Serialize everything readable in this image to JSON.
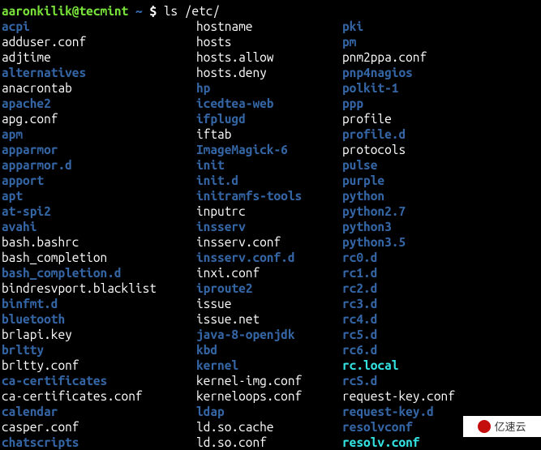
{
  "prompt": {
    "user_host": "aaronkilik@tecmint",
    "tilde": "~",
    "dollar": "$",
    "command": "ls /etc/"
  },
  "columns": [
    [
      {
        "name": "acpi",
        "type": "dir"
      },
      {
        "name": "adduser.conf",
        "type": "file"
      },
      {
        "name": "adjtime",
        "type": "file"
      },
      {
        "name": "alternatives",
        "type": "dir"
      },
      {
        "name": "anacrontab",
        "type": "file"
      },
      {
        "name": "apache2",
        "type": "dir"
      },
      {
        "name": "apg.conf",
        "type": "file"
      },
      {
        "name": "apm",
        "type": "dir"
      },
      {
        "name": "apparmor",
        "type": "dir"
      },
      {
        "name": "apparmor.d",
        "type": "dir"
      },
      {
        "name": "apport",
        "type": "dir"
      },
      {
        "name": "apt",
        "type": "dir"
      },
      {
        "name": "at-spi2",
        "type": "dir"
      },
      {
        "name": "avahi",
        "type": "dir"
      },
      {
        "name": "bash.bashrc",
        "type": "file"
      },
      {
        "name": "bash_completion",
        "type": "file"
      },
      {
        "name": "bash_completion.d",
        "type": "dir"
      },
      {
        "name": "bindresvport.blacklist",
        "type": "file"
      },
      {
        "name": "binfmt.d",
        "type": "dir"
      },
      {
        "name": "bluetooth",
        "type": "dir"
      },
      {
        "name": "brlapi.key",
        "type": "file"
      },
      {
        "name": "brltty",
        "type": "dir"
      },
      {
        "name": "brltty.conf",
        "type": "file"
      },
      {
        "name": "ca-certificates",
        "type": "dir"
      },
      {
        "name": "ca-certificates.conf",
        "type": "file"
      },
      {
        "name": "calendar",
        "type": "dir"
      },
      {
        "name": "casper.conf",
        "type": "file"
      },
      {
        "name": "chatscripts",
        "type": "dir"
      }
    ],
    [
      {
        "name": "hostname",
        "type": "file"
      },
      {
        "name": "hosts",
        "type": "file"
      },
      {
        "name": "hosts.allow",
        "type": "file"
      },
      {
        "name": "hosts.deny",
        "type": "file"
      },
      {
        "name": "hp",
        "type": "dir"
      },
      {
        "name": "icedtea-web",
        "type": "dir"
      },
      {
        "name": "ifplugd",
        "type": "dir"
      },
      {
        "name": "iftab",
        "type": "file"
      },
      {
        "name": "ImageMagick-6",
        "type": "dir"
      },
      {
        "name": "init",
        "type": "dir"
      },
      {
        "name": "init.d",
        "type": "dir"
      },
      {
        "name": "initramfs-tools",
        "type": "dir"
      },
      {
        "name": "inputrc",
        "type": "file"
      },
      {
        "name": "insserv",
        "type": "dir"
      },
      {
        "name": "insserv.conf",
        "type": "file"
      },
      {
        "name": "insserv.conf.d",
        "type": "dir"
      },
      {
        "name": "inxi.conf",
        "type": "file"
      },
      {
        "name": "iproute2",
        "type": "dir"
      },
      {
        "name": "issue",
        "type": "file"
      },
      {
        "name": "issue.net",
        "type": "file"
      },
      {
        "name": "java-8-openjdk",
        "type": "dir"
      },
      {
        "name": "kbd",
        "type": "dir"
      },
      {
        "name": "kernel",
        "type": "dir"
      },
      {
        "name": "kernel-img.conf",
        "type": "file"
      },
      {
        "name": "kerneloops.conf",
        "type": "file"
      },
      {
        "name": "ldap",
        "type": "dir"
      },
      {
        "name": "ld.so.cache",
        "type": "file"
      },
      {
        "name": "ld.so.conf",
        "type": "file"
      }
    ],
    [
      {
        "name": "pki",
        "type": "dir"
      },
      {
        "name": "pm",
        "type": "dir"
      },
      {
        "name": "pnm2ppa.conf",
        "type": "file"
      },
      {
        "name": "pnp4nagios",
        "type": "dir"
      },
      {
        "name": "polkit-1",
        "type": "dir"
      },
      {
        "name": "ppp",
        "type": "dir"
      },
      {
        "name": "profile",
        "type": "file"
      },
      {
        "name": "profile.d",
        "type": "dir"
      },
      {
        "name": "protocols",
        "type": "file"
      },
      {
        "name": "pulse",
        "type": "dir"
      },
      {
        "name": "purple",
        "type": "dir"
      },
      {
        "name": "python",
        "type": "dir"
      },
      {
        "name": "python2.7",
        "type": "dir"
      },
      {
        "name": "python3",
        "type": "dir"
      },
      {
        "name": "python3.5",
        "type": "dir"
      },
      {
        "name": "rc0.d",
        "type": "dir"
      },
      {
        "name": "rc1.d",
        "type": "dir"
      },
      {
        "name": "rc2.d",
        "type": "dir"
      },
      {
        "name": "rc3.d",
        "type": "dir"
      },
      {
        "name": "rc4.d",
        "type": "dir"
      },
      {
        "name": "rc5.d",
        "type": "dir"
      },
      {
        "name": "rc6.d",
        "type": "dir"
      },
      {
        "name": "rc.local",
        "type": "link"
      },
      {
        "name": "rcS.d",
        "type": "dir"
      },
      {
        "name": "request-key.conf",
        "type": "file"
      },
      {
        "name": "request-key.d",
        "type": "dir"
      },
      {
        "name": "resolvconf",
        "type": "dir"
      },
      {
        "name": "resolv.conf",
        "type": "link"
      }
    ]
  ],
  "badge": {
    "text": "亿速云"
  }
}
